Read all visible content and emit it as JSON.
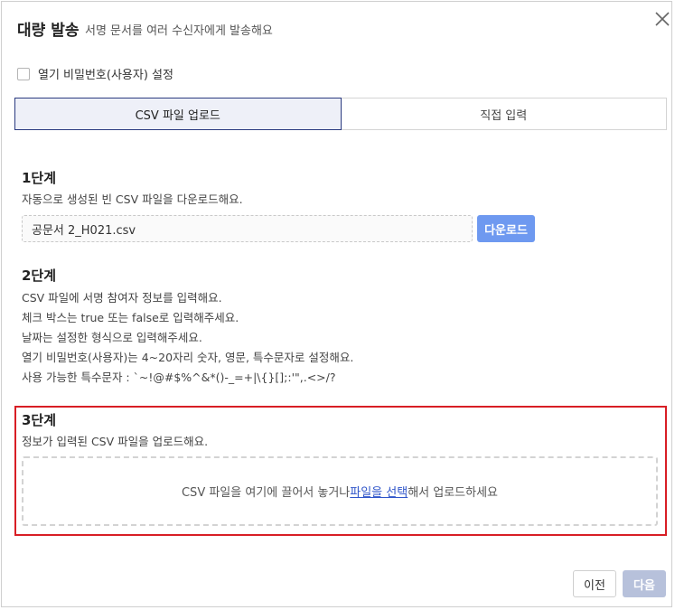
{
  "dialog": {
    "title": "대량 발송",
    "subtitle": "서명 문서를 여러 수신자에게 발송해요"
  },
  "password_option": {
    "label": "열기 비밀번호(사용자) 설정",
    "checked": false
  },
  "tabs": [
    {
      "label": "CSV 파일 업로드",
      "active": true
    },
    {
      "label": "직접 입력",
      "active": false
    }
  ],
  "step1": {
    "title": "1단계",
    "desc": "자동으로 생성된 빈 CSV 파일을 다운로드해요.",
    "file_name": "공문서 2_H021.csv",
    "download_label": "다운로드"
  },
  "step2": {
    "title": "2단계",
    "lines": [
      "CSV 파일에 서명 참여자 정보를 입력해요.",
      "체크 박스는 true 또는 false로 입력해주세요.",
      "날짜는 설정한 형식으로 입력해주세요.",
      "열기 비밀번호(사용자)는 4~20자리 숫자, 영문, 특수문자로 설정해요.",
      "사용 가능한 특수문자 : `~!@#$%^&*()-_=+|\\{}[];:'\",.<>/?"
    ]
  },
  "step3": {
    "title": "3단계",
    "desc": "정보가 입력된 CSV 파일을 업로드해요.",
    "drop_prefix": "CSV 파일을 여기에 끌어서 놓거나 ",
    "drop_link": "파일을 선택",
    "drop_suffix": "해서 업로드하세요"
  },
  "footer": {
    "prev_label": "이전",
    "next_label": "다음"
  },
  "colors": {
    "accent": "#6e99f0",
    "highlight_border": "#d81e25",
    "active_tab_border": "#2a3a80",
    "disabled_button": "#b7c1db"
  }
}
